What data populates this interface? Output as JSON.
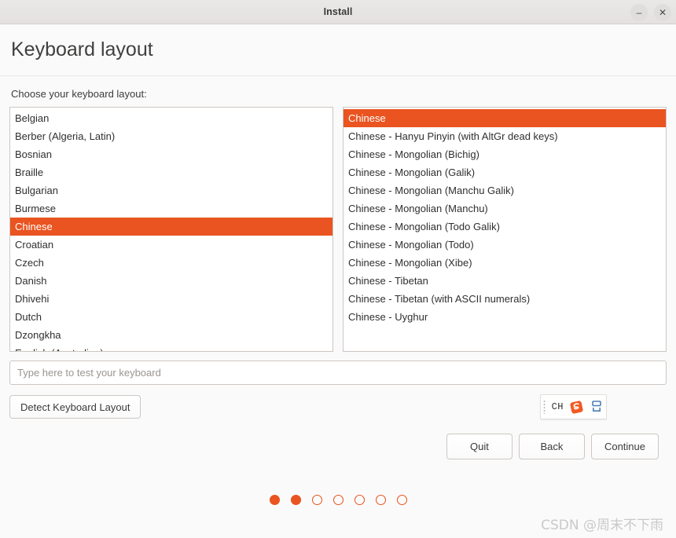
{
  "window": {
    "title": "Install",
    "minimize_label": "–",
    "close_label": "✕"
  },
  "header": {
    "page_title": "Keyboard layout"
  },
  "main": {
    "choose_label": "Choose your keyboard layout:",
    "layouts": [
      {
        "label": "Belgian",
        "selected": false
      },
      {
        "label": "Berber (Algeria, Latin)",
        "selected": false
      },
      {
        "label": "Bosnian",
        "selected": false
      },
      {
        "label": "Braille",
        "selected": false
      },
      {
        "label": "Bulgarian",
        "selected": false
      },
      {
        "label": "Burmese",
        "selected": false
      },
      {
        "label": "Chinese",
        "selected": true
      },
      {
        "label": "Croatian",
        "selected": false
      },
      {
        "label": "Czech",
        "selected": false
      },
      {
        "label": "Danish",
        "selected": false
      },
      {
        "label": "Dhivehi",
        "selected": false
      },
      {
        "label": "Dutch",
        "selected": false
      },
      {
        "label": "Dzongkha",
        "selected": false
      },
      {
        "label": "English (Australian)",
        "selected": false
      }
    ],
    "variants": [
      {
        "label": "Chinese",
        "selected": true
      },
      {
        "label": "Chinese - Hanyu Pinyin (with AltGr dead keys)",
        "selected": false
      },
      {
        "label": "Chinese - Mongolian (Bichig)",
        "selected": false
      },
      {
        "label": "Chinese - Mongolian (Galik)",
        "selected": false
      },
      {
        "label": "Chinese - Mongolian (Manchu Galik)",
        "selected": false
      },
      {
        "label": "Chinese - Mongolian (Manchu)",
        "selected": false
      },
      {
        "label": "Chinese - Mongolian (Todo Galik)",
        "selected": false
      },
      {
        "label": "Chinese - Mongolian (Todo)",
        "selected": false
      },
      {
        "label": "Chinese - Mongolian (Xibe)",
        "selected": false
      },
      {
        "label": "Chinese - Tibetan",
        "selected": false
      },
      {
        "label": "Chinese - Tibetan (with ASCII numerals)",
        "selected": false
      },
      {
        "label": "Chinese - Uyghur",
        "selected": false
      }
    ],
    "test_field": {
      "value": "",
      "placeholder": "Type here to test your keyboard"
    },
    "detect_button_label": "Detect Keyboard Layout"
  },
  "ime_tray": {
    "language_label": "CH",
    "logo_letter": "S"
  },
  "footer": {
    "quit_label": "Quit",
    "back_label": "Back",
    "continue_label": "Continue",
    "progress": {
      "total": 7,
      "current": 2
    }
  },
  "watermark": {
    "text": "CSDN @周末不下雨"
  },
  "colors": {
    "accent": "#e95420",
    "window_bg": "#fafafa",
    "titlebar_bg": "#e8e6e5",
    "border": "#cdc7c2"
  }
}
